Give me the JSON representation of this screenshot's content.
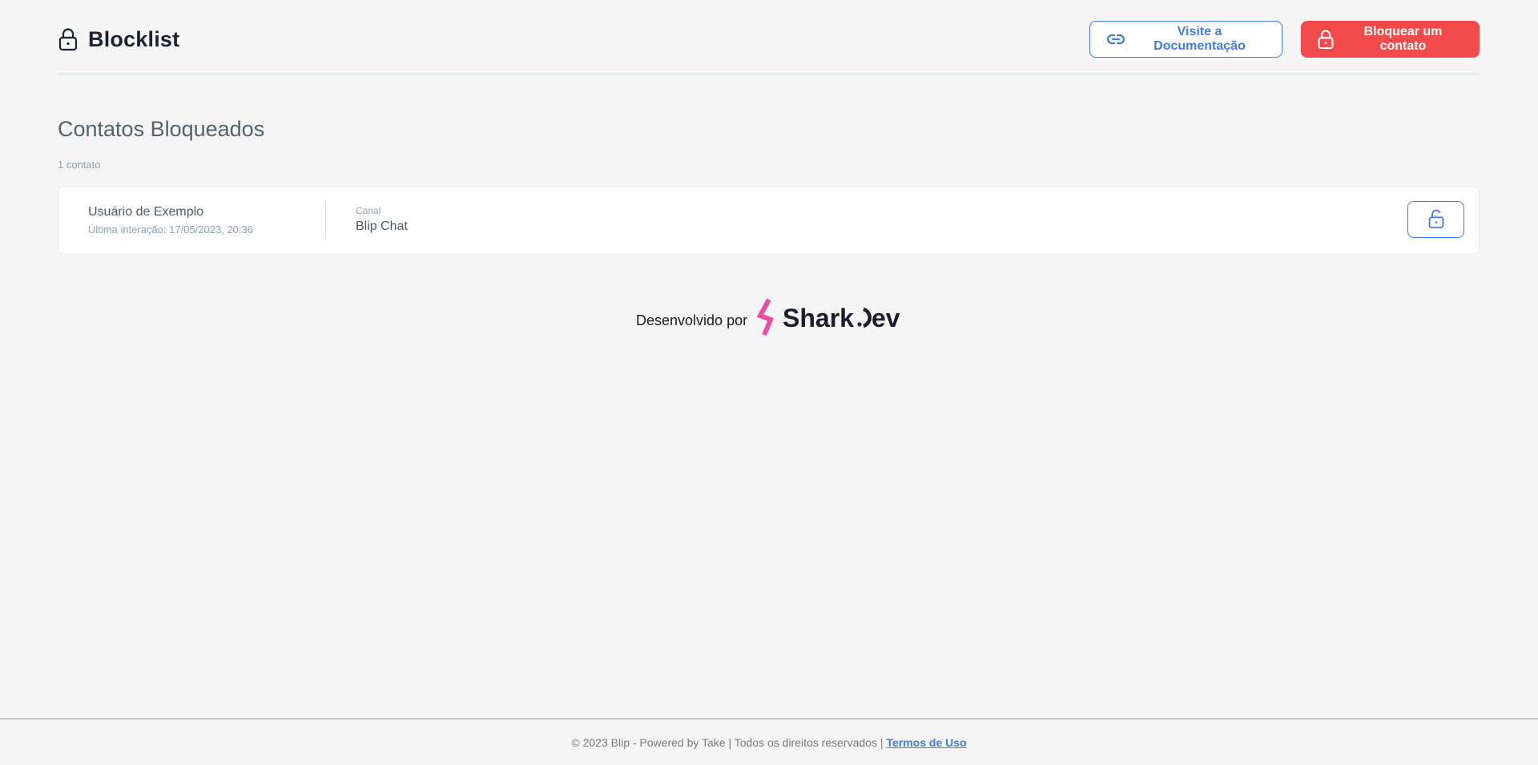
{
  "header": {
    "title": "Blocklist",
    "docs_button": "Visite a Documentação",
    "block_button": "Bloquear um contato"
  },
  "section": {
    "title": "Contatos Bloqueados",
    "count": "1 contato"
  },
  "contacts": [
    {
      "name": "Usuário de Exemplo",
      "last_interaction": "Última interação: 17/05/2023, 20:36",
      "channel_label": "Canal",
      "channel": "Blip Chat"
    }
  ],
  "credit": {
    "text": "Desenvolvido por",
    "logo_text": "Shark.Dev"
  },
  "footer": {
    "text": "© 2023 Blip - Powered by Take | Todos os direitos reservados |",
    "terms_link": "Termos de Uso"
  },
  "colors": {
    "primary": "#3f7de8",
    "danger": "#f34b4b",
    "logo_pink": "#e94da5"
  }
}
